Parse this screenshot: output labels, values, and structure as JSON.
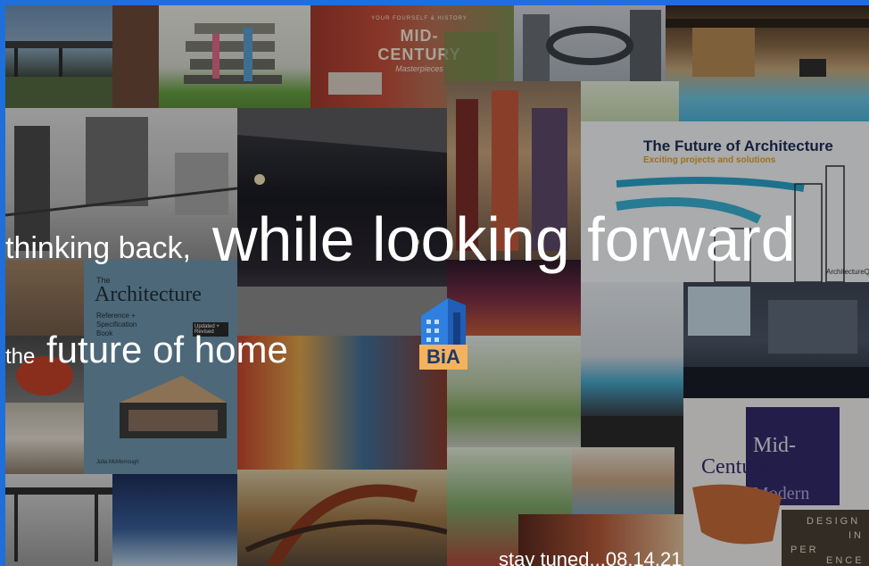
{
  "overlay": {
    "line1_small": "thinking back,",
    "line1_large": "while looking forward",
    "line2_small": "the",
    "line2_large": "future of home",
    "stay_tuned": "stay tuned...08.14.21"
  },
  "logo": {
    "text": "BiA",
    "colors": {
      "building": "#2f7fe0",
      "plate": "#f3b25e",
      "text": "#1b3a6b"
    }
  },
  "tiles": {
    "mid_century_banner": {
      "line1": "YOUR FOURSELF & HISTORY",
      "line2": "MID-CENTURY",
      "line3": "Masterpieces"
    },
    "future_architecture": {
      "title": "The Future of Architecture",
      "subtitle": "Exciting projects and solutions",
      "footer": "ArchitectureQuarterly"
    },
    "book": {
      "the": "The",
      "title": "Architecture",
      "sub1": "Reference +",
      "sub2": "Specification",
      "sub3": "Book",
      "badge": "Updated + Revised",
      "author": "Julia McMorrough"
    },
    "mid_century_modern": {
      "line1": "Mid-",
      "line2": "Century",
      "line3": "Modern"
    },
    "design": {
      "line1": "DESIGN",
      "line2": "IN",
      "line3": "PER",
      "line4": "ENCE"
    }
  },
  "colors": {
    "frame": "#1e6fdb",
    "text": "#ffffff",
    "fa_title": "#1f2d56",
    "fa_subtitle": "#e2a225"
  }
}
